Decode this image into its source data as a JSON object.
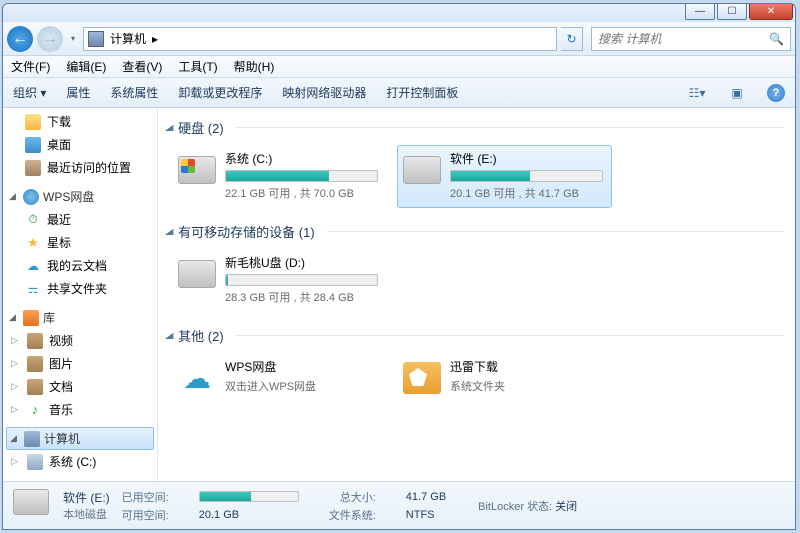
{
  "titlebar": {
    "min": "—",
    "max": "☐",
    "close": "✕"
  },
  "nav": {
    "back_glyph": "←",
    "fwd_glyph": "→",
    "dd_glyph": "▾",
    "breadcrumb_sep": "▸",
    "breadcrumb_item": "计算机",
    "refresh_glyph": "↻",
    "search_placeholder": "搜索 计算机",
    "search_glyph": "🔍"
  },
  "menu": {
    "file": "文件(F)",
    "edit": "编辑(E)",
    "view": "查看(V)",
    "tools": "工具(T)",
    "help": "帮助(H)"
  },
  "toolbar": {
    "organize": "组织 ▾",
    "properties": "属性",
    "sys_properties": "系统属性",
    "uninstall": "卸载或更改程序",
    "map_drive": "映射网络驱动器",
    "control_panel": "打开控制面板",
    "view_glyph": "☷▾",
    "preview_glyph": "▣",
    "help_glyph": "?"
  },
  "sidebar": {
    "downloads": "下载",
    "desktop": "桌面",
    "recent_places": "最近访问的位置",
    "wps_group": "WPS网盘",
    "wps_recent": "最近",
    "wps_star": "星标",
    "wps_docs": "我的云文档",
    "wps_share": "共享文件夹",
    "lib_group": "库",
    "lib_video": "视频",
    "lib_pics": "图片",
    "lib_docs": "文档",
    "lib_music": "音乐",
    "computer": "计算机",
    "sys_c": "系统 (C:)",
    "tri_open": "◢",
    "tri_closed": "▷"
  },
  "sections": {
    "hdd": "硬盘 (2)",
    "removable": "有可移动存储的设备 (1)",
    "other": "其他 (2)"
  },
  "drives": {
    "c": {
      "name": "系统 (C:)",
      "text": "22.1 GB 可用 , 共 70.0 GB",
      "fill_pct": 68
    },
    "e": {
      "name": "软件 (E:)",
      "text": "20.1 GB 可用 , 共 41.7 GB",
      "fill_pct": 52
    },
    "d": {
      "name": "新毛桃U盘 (D:)",
      "text": "28.3 GB 可用 , 共 28.4 GB",
      "fill_pct": 1
    },
    "wps": {
      "name": "WPS网盘",
      "sub": "双击进入WPS网盘"
    },
    "xl": {
      "name": "迅雷下载",
      "sub": "系统文件夹"
    }
  },
  "details": {
    "title": "软件 (E:)",
    "type": "本地磁盘",
    "used_label": "已用空间:",
    "free_label": "可用空间:",
    "free_val": "20.1 GB",
    "total_label": "总大小:",
    "total_val": "41.7 GB",
    "fs_label": "文件系统:",
    "fs_val": "NTFS",
    "bl_label": "BitLocker 状态:",
    "bl_val": "关闭",
    "used_pct": 52
  }
}
